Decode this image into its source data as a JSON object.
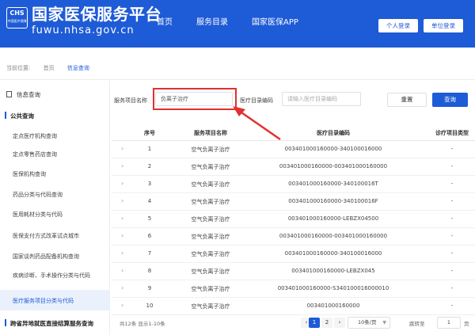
{
  "header": {
    "logo_line1": "CHS",
    "logo_line2": "中国医疗保障",
    "title": "国家医保服务平台",
    "url": "fuwu.nhsa.gov.cn",
    "nav": [
      "首页",
      "服务目录",
      "国家医保APP"
    ],
    "login_personal": "个人登录",
    "login_unit": "单位登录"
  },
  "breadcrumb": {
    "label": "当前位置:",
    "items": [
      "首页",
      "信息查询"
    ]
  },
  "sidebar": {
    "header": "信息查询",
    "section1": "公共查询",
    "items": [
      "定点医疗机构查询",
      "定点零售药店查询",
      "医保机构查询",
      "药品分类与代码查询",
      "医用耗材分类与代码",
      "医保支付方式改革试点城市",
      "国家谈判药品配备机构查询",
      "疾病诊断、手术操作分类与代码",
      "医疗服务项目分类与代码"
    ],
    "active_index": 8,
    "section2": "跨省异地就医直接结算服务查询"
  },
  "filters": {
    "service_label": "服务项目名称",
    "service_value": "负离子治疗",
    "code_label": "医疗目录编码",
    "code_placeholder": "请输入医疗目录编码",
    "reset_label": "重置",
    "query_label": "查询"
  },
  "table": {
    "headers": [
      "序号",
      "服务项目名称",
      "医疗目录编码",
      "诊疗项目类型"
    ],
    "rows": [
      {
        "index": "1",
        "name": "空气负离子治疗",
        "code": "003401000160000-340100016000",
        "type": "-"
      },
      {
        "index": "2",
        "name": "空气负离子治疗",
        "code": "003401000160000-003401000160000",
        "type": "-"
      },
      {
        "index": "3",
        "name": "空气负离子治疗",
        "code": "003401000160000-340100016T",
        "type": "-"
      },
      {
        "index": "4",
        "name": "空气负离子治疗",
        "code": "003401000160000-340100016F",
        "type": "-"
      },
      {
        "index": "5",
        "name": "空气负离子治疗",
        "code": "003401000160000-LEBZX04500",
        "type": "-"
      },
      {
        "index": "6",
        "name": "空气负离子治疗",
        "code": "003401000160000-003401000160000",
        "type": "-"
      },
      {
        "index": "7",
        "name": "空气负离子治疗",
        "code": "003401000160000-340100016000",
        "type": "-"
      },
      {
        "index": "8",
        "name": "空气负离子治疗",
        "code": "003401000160000-LEBZX045",
        "type": "-"
      },
      {
        "index": "9",
        "name": "空气负离子治疗",
        "code": "003401000160000-S340100016000010",
        "type": "-"
      },
      {
        "index": "10",
        "name": "空气负离子治疗",
        "code": "003401000160000",
        "type": "-"
      }
    ]
  },
  "pagination": {
    "total_text": "共12条 显示1-10条",
    "pages": [
      "1",
      "2"
    ],
    "current": "1",
    "prev": "‹",
    "next": "›",
    "page_size": "10条/页",
    "goto_label": "跳转至",
    "goto_value": "1",
    "page_unit": "页"
  }
}
